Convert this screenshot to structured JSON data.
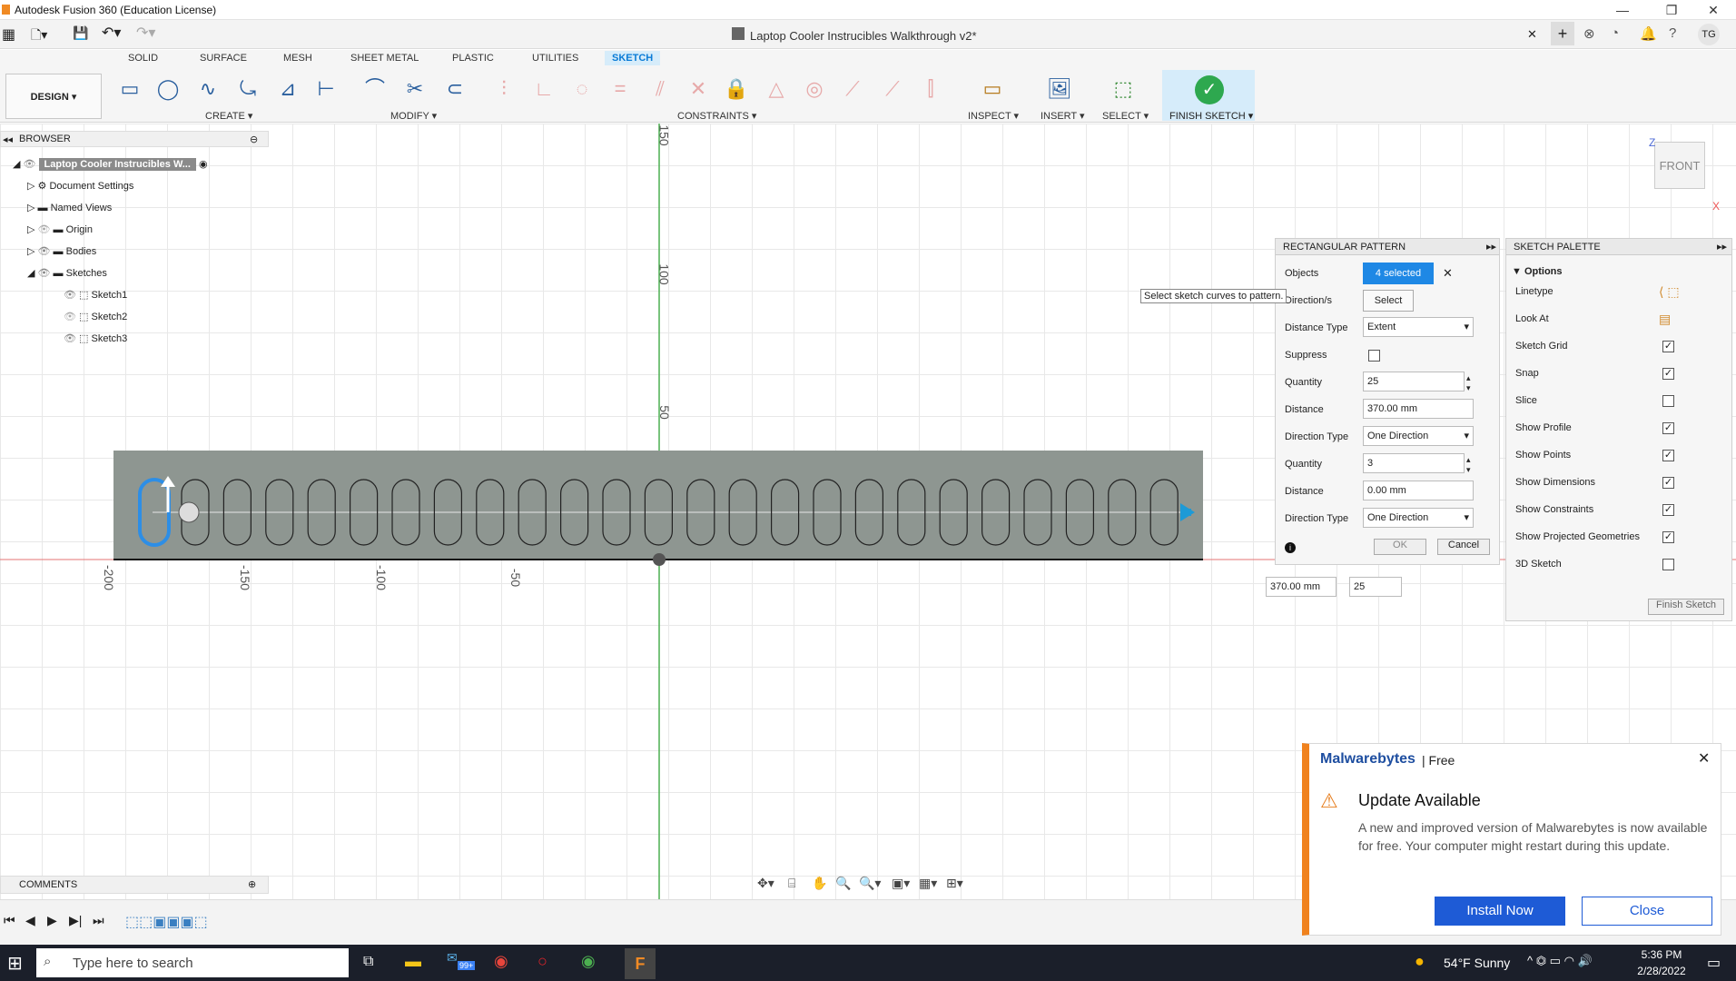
{
  "window": {
    "title": "Autodesk Fusion 360 (Education License)",
    "doc_title": "Laptop Cooler Instrucibles Walkthrough v2*",
    "user": "TG"
  },
  "tabs": [
    "SOLID",
    "SURFACE",
    "MESH",
    "SHEET METAL",
    "PLASTIC",
    "UTILITIES",
    "SKETCH"
  ],
  "ribbon": {
    "design": "DESIGN ▾",
    "create": "CREATE ▾",
    "modify": "MODIFY ▾",
    "constraints": "CONSTRAINTS ▾",
    "inspect": "INSPECT ▾",
    "insert": "INSERT ▾",
    "select": "SELECT ▾",
    "finish": "FINISH SKETCH ▾"
  },
  "browser": {
    "title": "BROWSER",
    "root": "Laptop Cooler Instrucibles W...",
    "items": [
      "Document Settings",
      "Named Views",
      "Origin",
      "Bodies",
      "Sketches",
      "Sketch1",
      "Sketch2",
      "Sketch3"
    ]
  },
  "comments": "COMMENTS",
  "viewcube": {
    "face": "FRONT",
    "z": "Z",
    "x": "X"
  },
  "axis": {
    "v": [
      "150",
      "100",
      "50"
    ],
    "h": [
      "-200",
      "-150",
      "-100",
      "-50"
    ]
  },
  "pattern": {
    "title": "RECTANGULAR PATTERN",
    "objects_label": "Objects",
    "objects_value": "4 selected",
    "direction_label": "Direction/s",
    "direction_value": "Select",
    "tooltip": "Select sketch curves to pattern.",
    "dist_type_label": "Distance Type",
    "dist_type_value": "Extent",
    "suppress_label": "Suppress",
    "qty_label": "Quantity",
    "qty1": "25",
    "dist_label": "Distance",
    "dist1": "370.00 mm",
    "dir_type_label": "Direction Type",
    "dir1": "One Direction",
    "qty2": "3",
    "dist2": "0.00 mm",
    "dir2": "One Direction",
    "ok": "OK",
    "cancel": "Cancel"
  },
  "onscreen": {
    "dist": "370.00 mm",
    "qty": "25"
  },
  "palette": {
    "title": "SKETCH PALETTE",
    "options": "▼ Options",
    "rows": [
      "Linetype",
      "Look At",
      "Sketch Grid",
      "Snap",
      "Slice",
      "Show Profile",
      "Show Points",
      "Show Dimensions",
      "Show Constraints",
      "Show Projected Geometries",
      "3D Sketch"
    ],
    "checked": [
      null,
      null,
      true,
      true,
      false,
      true,
      true,
      true,
      true,
      true,
      false
    ],
    "finish": "Finish Sketch"
  },
  "toast": {
    "brand": "Malwarebytes",
    "tier": "Free",
    "title": "Update Available",
    "body": "A new and improved version of Malwarebytes is now available for free. Your computer might restart during this update.",
    "install": "Install Now",
    "close": "Close"
  },
  "taskbar": {
    "search": "Type here to search",
    "weather": "54°F  Sunny",
    "time": "5:36 PM",
    "date": "2/28/2022",
    "badge": "99+"
  }
}
